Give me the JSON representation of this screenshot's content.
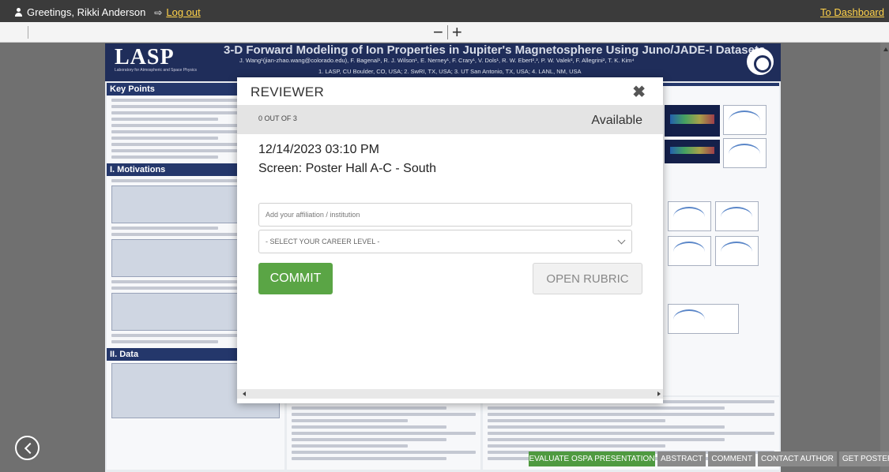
{
  "topbar": {
    "greeting": "Greetings, Rikki Anderson",
    "logout": "Log out",
    "dashboard_link": "To Dashboard"
  },
  "zoom": {
    "minus": "−",
    "plus": "+"
  },
  "poster": {
    "logo": "LASP",
    "logo_sub": "Laboratory for Atmospheric and Space Physics",
    "title": "3-D Forward Modeling of Ion Properties in Jupiter's Magnetosphere Using Juno/JADE-I Datasets",
    "authors": "J. Wang¹(jian-zhao.wang@colorado.edu), F. Bagenal¹, R. J. Wilson¹, E. Nerney¹, F. Crary¹, V. Dols¹, R. W. Ebert²,³, P. W. Valek², F. Allegrini², T. K. Kim⁴",
    "affiliations": "1. LASP, CU Boulder, CO, USA; 2. SwRI, TX, USA; 3. UT San Antonio, TX, USA; 4. LANL, NM, USA",
    "sections": {
      "key_points": "Key Points",
      "motivations": "I. Motivations",
      "data": "II. Data"
    }
  },
  "modal": {
    "title": "REVIEWER",
    "close": "✖",
    "count": "0 OUT OF 3",
    "availability": "Available",
    "datetime": "12/14/2023 03:10 PM",
    "screen": "Screen: Poster Hall A-C - South",
    "affiliation_placeholder": "Add your affiliation / institution",
    "career_level": "- SELECT YOUR CAREER LEVEL -",
    "commit": "COMMIT",
    "open_rubric": "OPEN RUBRIC"
  },
  "actions": {
    "evaluate": "EVALUATE OSPA PRESENTATION",
    "abstract": "ABSTRACT",
    "comment": "COMMENT",
    "contact": "CONTACT AUTHOR",
    "get_poster": "GET POSTER"
  }
}
